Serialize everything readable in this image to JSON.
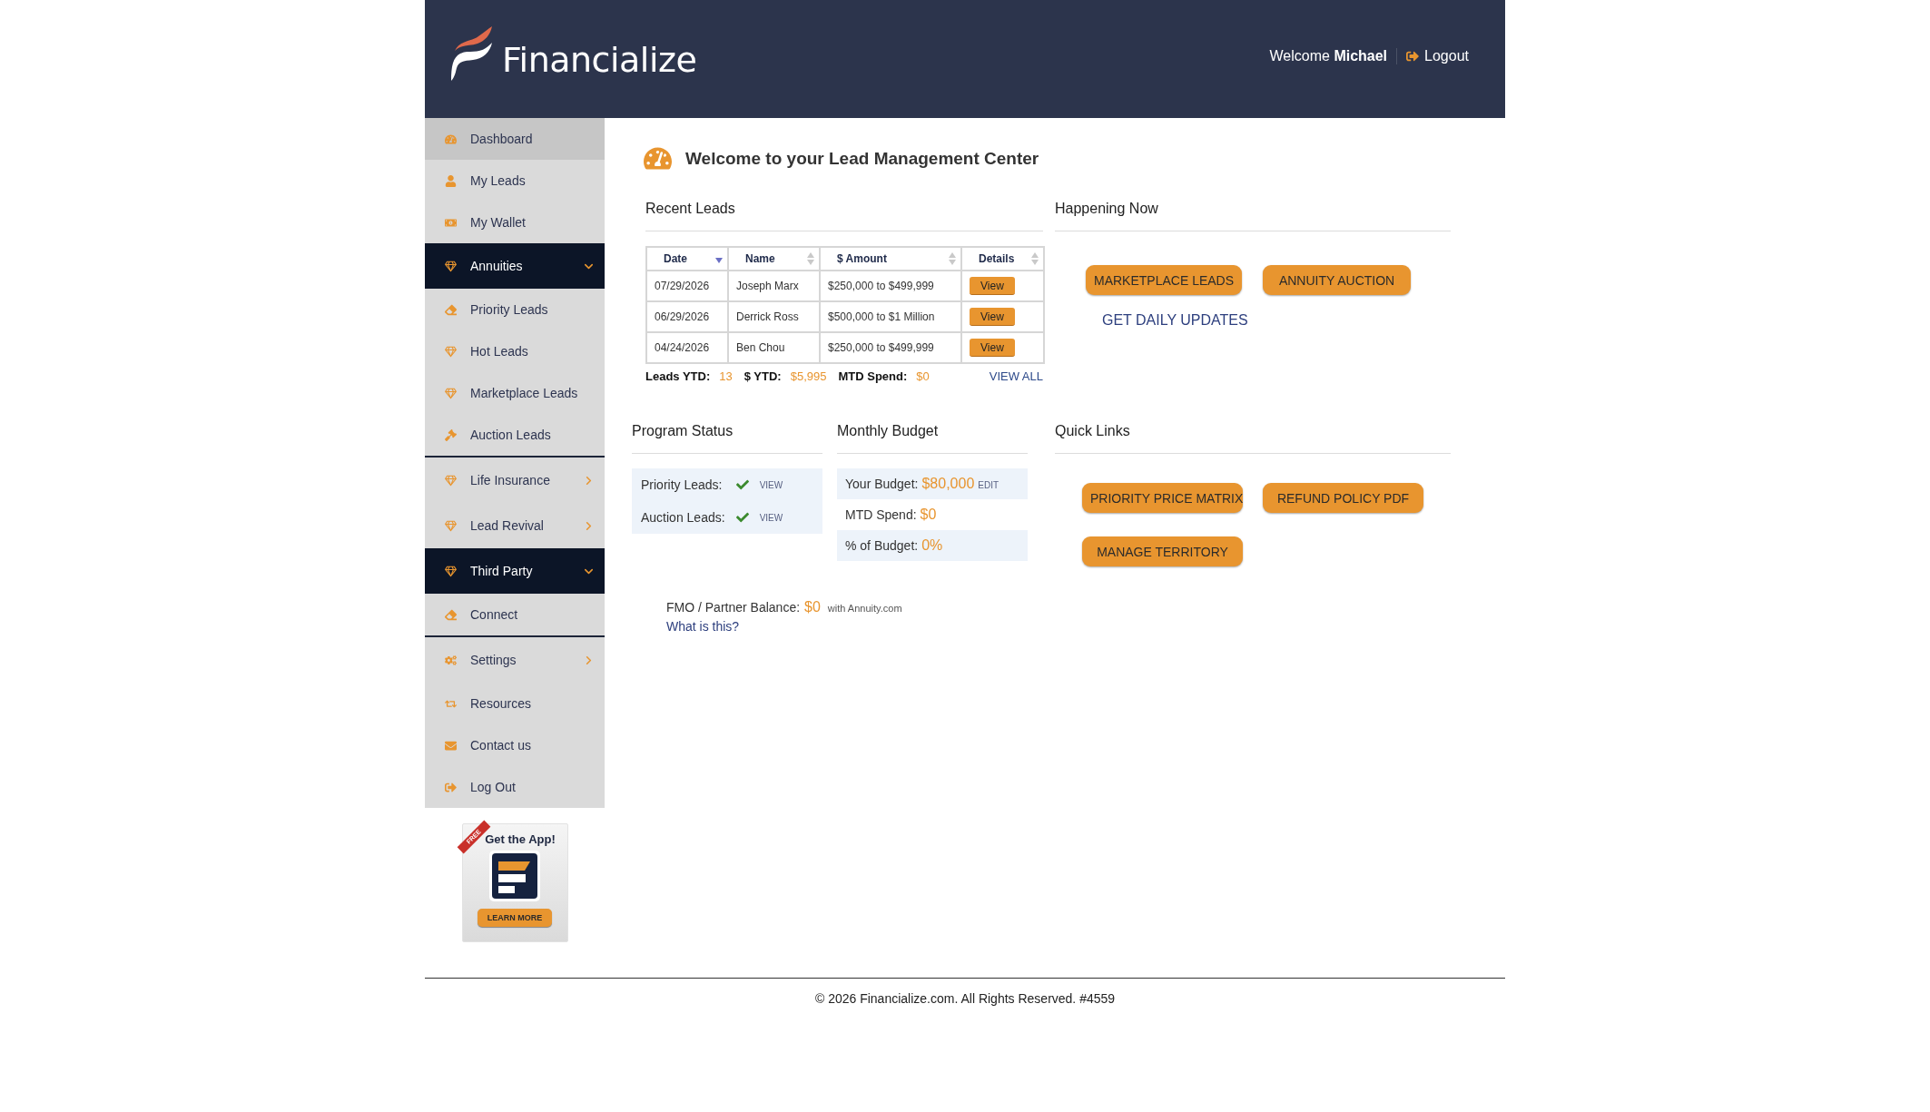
{
  "header": {
    "logo": "Financialize",
    "welcome": "Welcome **Michael**",
    "logout": "Logout"
  },
  "sidebar": {
    "items": [
      {
        "kind": "link",
        "label": "Dashboard",
        "selected": true
      },
      {
        "kind": "link",
        "label": "My Leads",
        "selected": false
      },
      {
        "kind": "link",
        "label": "My Wallet",
        "selected": false
      },
      {
        "kind": "group",
        "label": "Annuities",
        "expanded": true,
        "children": [
          {
            "kind": "link",
            "label": "Priority Leads",
            "selected": false
          },
          {
            "kind": "link",
            "label": "Hot Leads",
            "selected": false
          },
          {
            "kind": "link",
            "label": "Marketplace Leads",
            "selected": false
          },
          {
            "kind": "link",
            "label": "Auction Leads",
            "selected": false
          }
        ]
      },
      {
        "kind": "group",
        "label": "Life Insurance",
        "expanded": false
      },
      {
        "kind": "group",
        "label": "Lead Revival",
        "expanded": false
      },
      {
        "kind": "group",
        "label": "Third Party",
        "expanded": true,
        "children": [
          {
            "kind": "link",
            "label": "Connect",
            "selected": false
          }
        ]
      },
      {
        "kind": "group",
        "label": "Settings",
        "expanded": false
      },
      {
        "kind": "link",
        "label": "Resources",
        "selected": false
      },
      {
        "kind": "link",
        "label": "Contact us",
        "selected": false
      },
      {
        "kind": "link",
        "label": "Log Out",
        "selected": false
      }
    ]
  },
  "app_promo": {
    "ribbon": "FREE",
    "title": "Get the App!",
    "button": "LEARN MORE"
  },
  "page_title": "Welcome to your Lead Management Center",
  "recent_leads": {
    "title": "Recent Leads",
    "columns": [
      {
        "label": "Date",
        "sorted": true
      },
      {
        "label": "Name",
        "sorted": false
      },
      {
        "label": "$ Amount",
        "sorted": false
      },
      {
        "label": "Details",
        "sorted": false
      }
    ],
    "rows": [
      {
        "date": "07/29/2026",
        "name": "Joseph Marx",
        "amount": "$250,000 to $499,999",
        "action": "View"
      },
      {
        "date": "06/29/2026",
        "name": "Derrick Ross",
        "amount": "$500,000 to $1 Million",
        "action": "View"
      },
      {
        "date": "04/24/2026",
        "name": "Ben Chou",
        "amount": "$250,000 to $499,999",
        "action": "View"
      }
    ],
    "stats": [
      {
        "label": "Leads YTD:",
        "value": "13"
      },
      {
        "label": "$ YTD:",
        "value": "$5,995"
      },
      {
        "label": "MTD Spend:",
        "value": "$0"
      }
    ],
    "link": "VIEW ALL"
  },
  "happening_now": {
    "title": "Happening Now",
    "buttons": [
      "MARKETPLACE LEADS",
      "ANNUITY AUCTION"
    ],
    "link": "GET DAILY UPDATES"
  },
  "program_status": {
    "title": "Program Status",
    "items": [
      {
        "label": "Priority Leads:",
        "checked": true,
        "link": "VIEW"
      },
      {
        "label": "Auction Leads:",
        "checked": true,
        "link": "VIEW"
      }
    ]
  },
  "monthly_budget": {
    "title": "Monthly Budget",
    "rows": [
      {
        "label": "Your Budget:",
        "value": "$80,000",
        "action": "EDIT"
      },
      {
        "label": "MTD Spend:",
        "value": "$0"
      },
      {
        "label": "% of Budget:",
        "value": "0%"
      }
    ]
  },
  "quick_links": {
    "title": "Quick Links",
    "buttons": [
      "PRIORITY PRICE MATRIX",
      "REFUND POLICY PDF",
      "MANAGE TERRITORY"
    ]
  },
  "partner_balance": {
    "label": "FMO / Partner Balance:",
    "value": "$0",
    "note": "with Annuity.com",
    "link": "What is this?"
  },
  "footer": "© 2026 Financialize.com. All Rights Reserved. #4559"
}
